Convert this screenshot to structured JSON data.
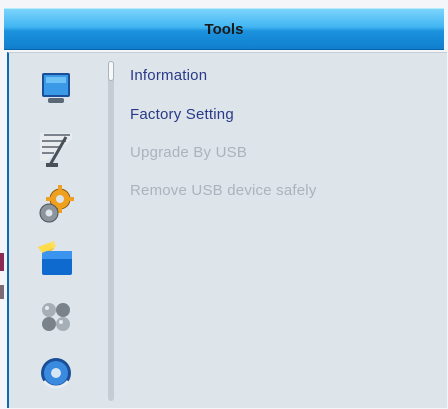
{
  "window": {
    "title": "Tools"
  },
  "sidebar": {
    "icons": [
      {
        "name": "monitor-icon"
      },
      {
        "name": "satellite-dish-icon"
      },
      {
        "name": "gear-icon"
      },
      {
        "name": "folder-icon"
      },
      {
        "name": "dots-cluster-icon"
      },
      {
        "name": "media-disc-icon"
      }
    ]
  },
  "menu": {
    "items": [
      {
        "label": "Information",
        "enabled": true
      },
      {
        "label": "Factory Setting",
        "enabled": true
      },
      {
        "label": "Upgrade By USB",
        "enabled": false
      },
      {
        "label": "Remove USB device safely",
        "enabled": false
      }
    ]
  },
  "colors": {
    "title_bar": "#41b5f2",
    "panel": "#dde4ea",
    "enabled_text": "#2a3a88",
    "disabled_text": "#aab4bd",
    "accent_border": "#0f6ab3"
  }
}
